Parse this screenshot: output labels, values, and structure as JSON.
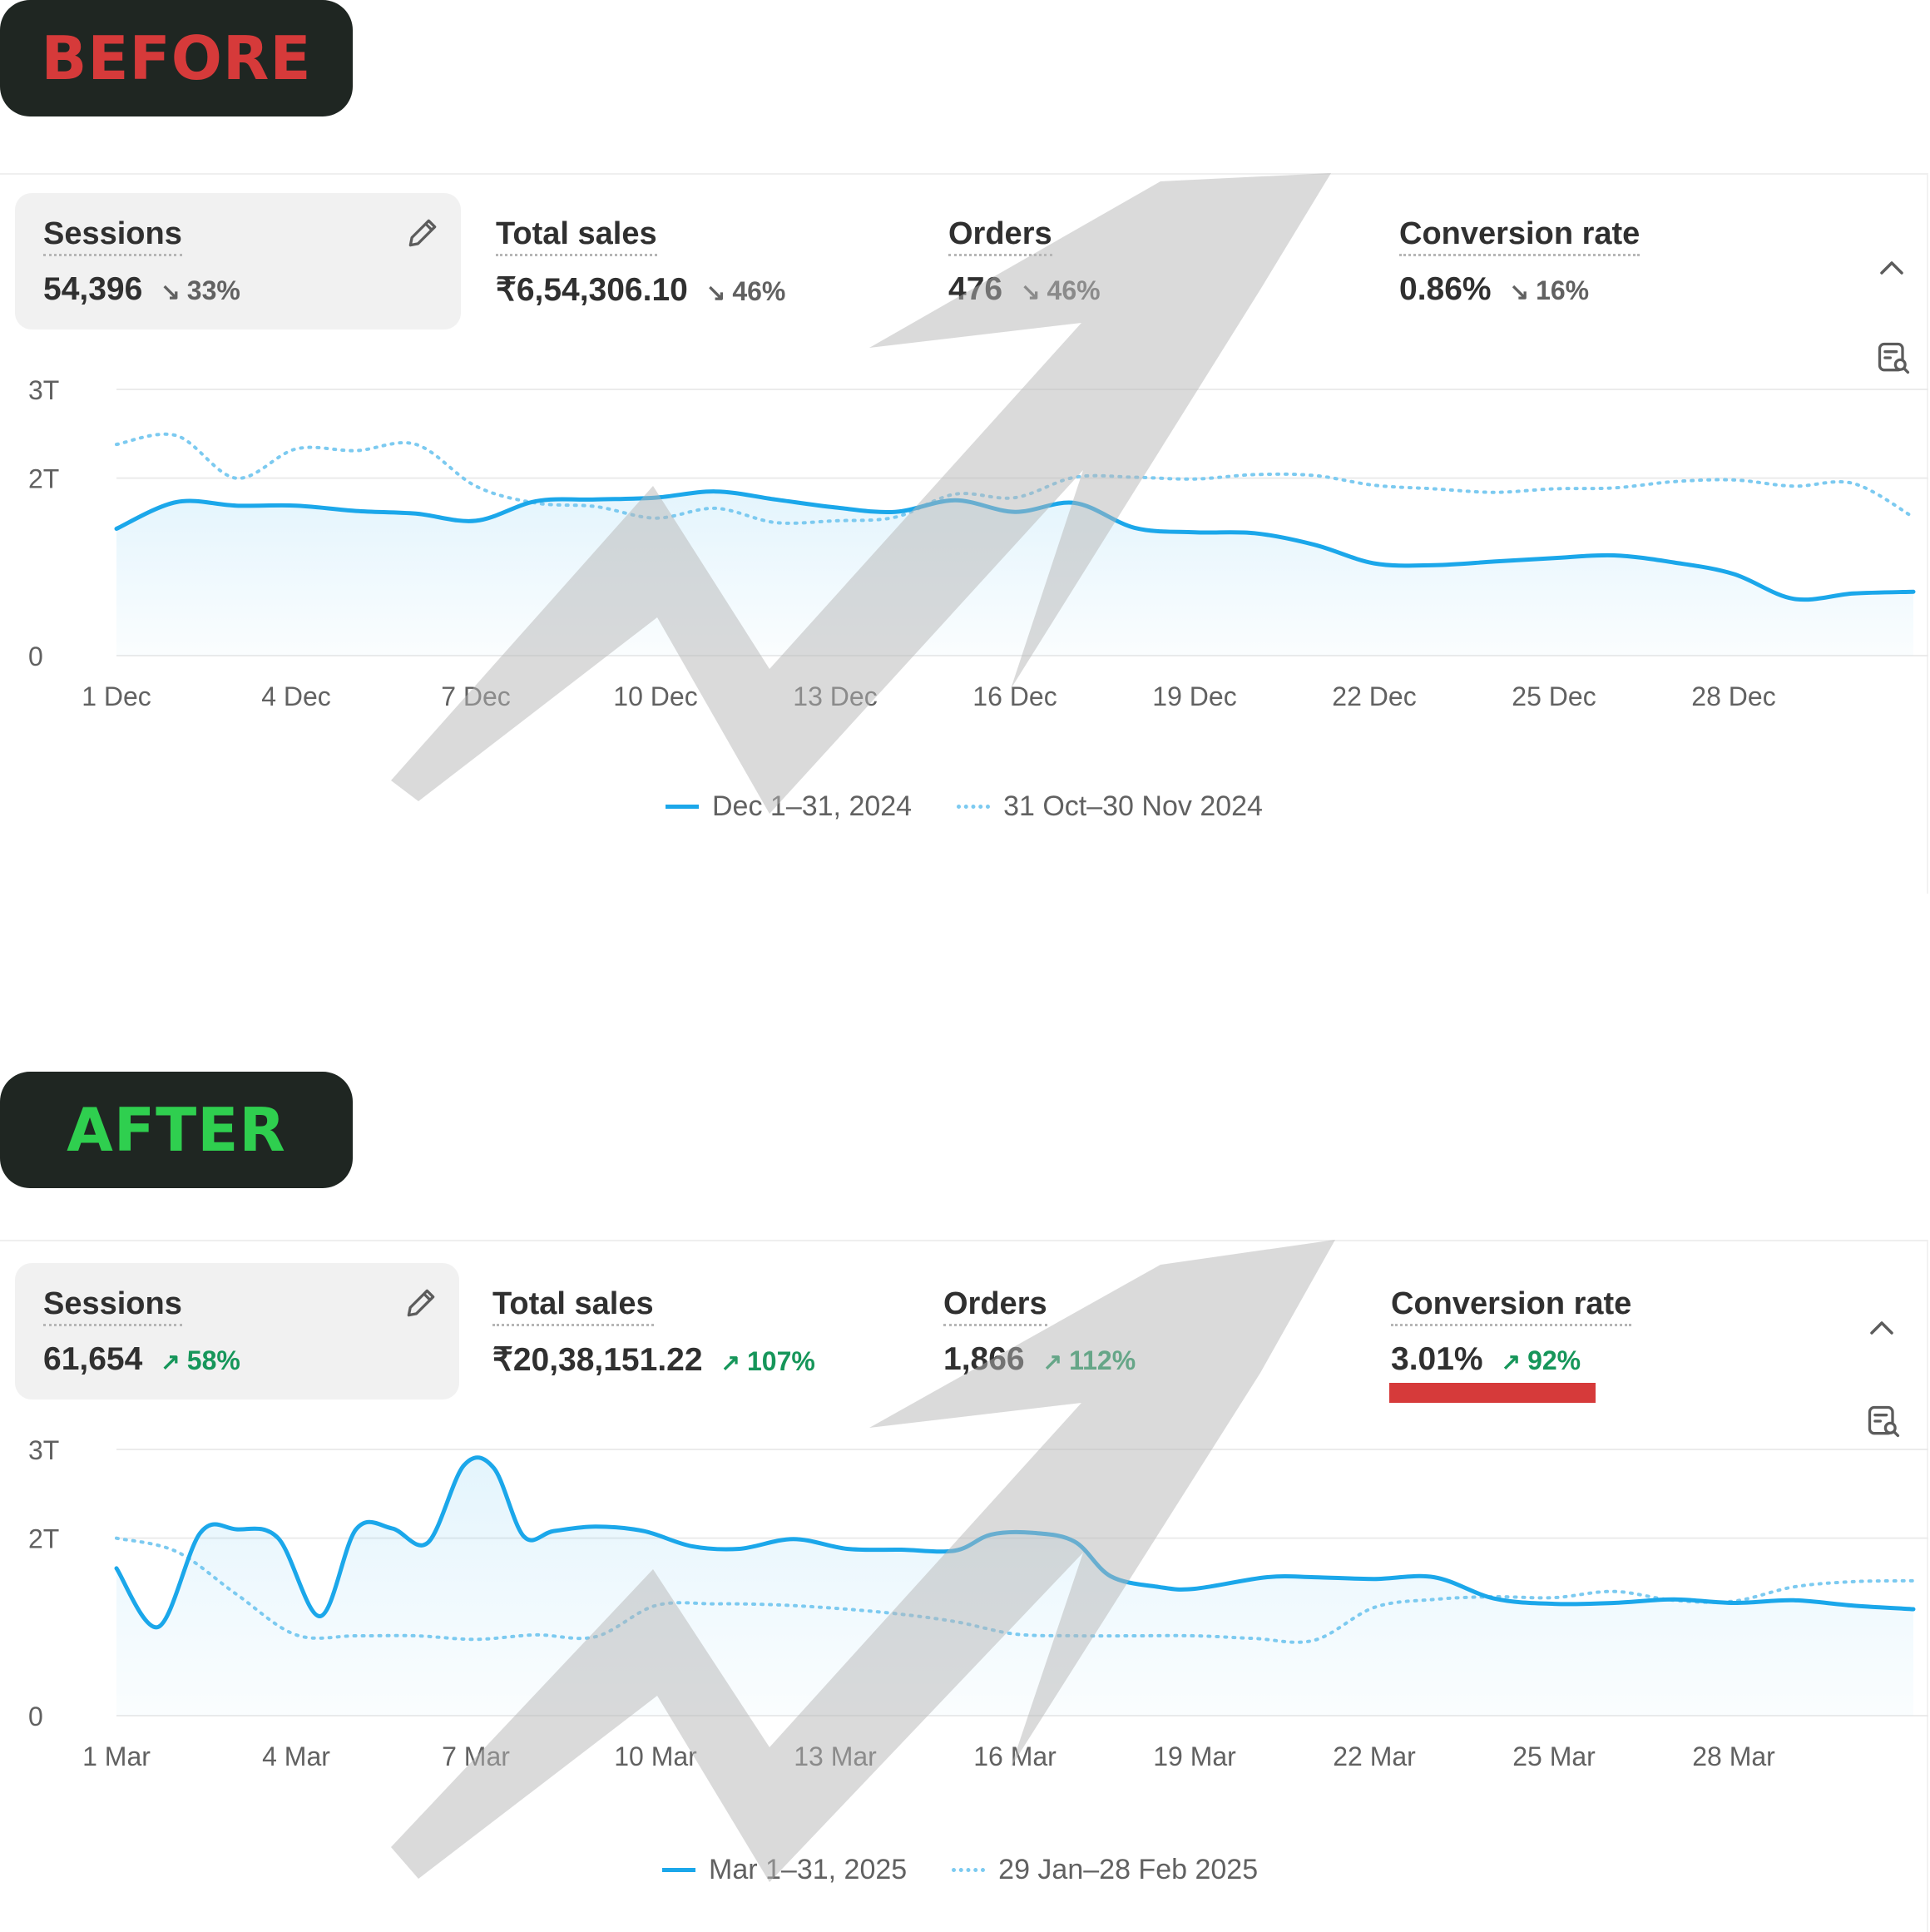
{
  "labels": {
    "before": "BEFORE",
    "after": "AFTER"
  },
  "colors": {
    "series_current": "#1ba7ea",
    "series_previous": "#7ccaf0",
    "up": "#16965a",
    "down": "#616161",
    "badge_bg": "#1f2622",
    "before_text": "#d63a3a",
    "after_text": "#2fcf4f",
    "highlight": "#d63a3a"
  },
  "icons": {
    "edit": "pencil-icon",
    "collapse": "chevron-up-icon",
    "report": "report-search-icon",
    "watermark": "trend-up-arrow-icon"
  },
  "before": {
    "metrics": [
      {
        "label": "Sessions",
        "value": "54,396",
        "delta": "33%",
        "direction": "down",
        "selected": true
      },
      {
        "label": "Total sales",
        "value": "₹6,54,306.10",
        "delta": "46%",
        "direction": "down"
      },
      {
        "label": "Orders",
        "value": "476",
        "delta": "46%",
        "direction": "down"
      },
      {
        "label": "Conversion rate",
        "value": "0.86%",
        "delta": "16%",
        "direction": "down"
      }
    ],
    "legend": {
      "current": "Dec 1–31, 2024",
      "previous": "31 Oct–30 Nov 2024"
    }
  },
  "after": {
    "metrics": [
      {
        "label": "Sessions",
        "value": "61,654",
        "delta": "58%",
        "direction": "up",
        "selected": true
      },
      {
        "label": "Total sales",
        "value": "₹20,38,151.22",
        "delta": "107%",
        "direction": "up"
      },
      {
        "label": "Orders",
        "value": "1,866",
        "delta": "112%",
        "direction": "up"
      },
      {
        "label": "Conversion rate",
        "value": "3.01%",
        "delta": "92%",
        "direction": "up",
        "highlighted": true
      }
    ],
    "legend": {
      "current": "Mar 1–31, 2025",
      "previous": "29 Jan–28 Feb 2025"
    }
  },
  "chart_data": [
    {
      "type": "line",
      "yticks": [
        "0",
        "2T",
        "3T"
      ],
      "ylim": [
        0,
        3000
      ],
      "x_tick_labels": [
        "1 Dec",
        "4 Dec",
        "7 Dec",
        "10 Dec",
        "13 Dec",
        "16 Dec",
        "19 Dec",
        "22 Dec",
        "25 Dec",
        "28 Dec"
      ],
      "x_tick_days": [
        1,
        4,
        7,
        10,
        13,
        16,
        19,
        22,
        25,
        28
      ],
      "xlim": [
        1,
        31
      ],
      "grid": true,
      "legend_position": "bottom",
      "series": [
        {
          "name": "Dec 1–31, 2024",
          "style": "solid",
          "x": [
            1,
            2,
            3,
            4,
            5,
            6,
            7,
            8,
            9,
            10,
            11,
            12,
            13,
            14,
            15,
            16,
            17,
            18,
            19,
            20,
            21,
            22,
            23,
            24,
            25,
            26,
            27,
            28,
            29,
            30,
            31
          ],
          "values": [
            1430,
            1730,
            1690,
            1690,
            1630,
            1600,
            1520,
            1740,
            1760,
            1780,
            1850,
            1760,
            1670,
            1620,
            1750,
            1620,
            1720,
            1440,
            1390,
            1380,
            1250,
            1040,
            1020,
            1060,
            1100,
            1130,
            1050,
            920,
            640,
            700,
            720
          ]
        },
        {
          "name": "31 Oct–30 Nov 2024",
          "style": "dotted",
          "x": [
            1,
            2,
            3,
            4,
            5,
            6,
            7,
            8,
            9,
            10,
            11,
            12,
            13,
            14,
            15,
            16,
            17,
            18,
            19,
            20,
            21,
            22,
            23,
            24,
            25,
            26,
            27,
            28,
            29,
            30,
            31
          ],
          "values": [
            2380,
            2480,
            2000,
            2330,
            2310,
            2380,
            1910,
            1720,
            1680,
            1550,
            1660,
            1500,
            1520,
            1560,
            1820,
            1780,
            2010,
            2010,
            1990,
            2040,
            2030,
            1920,
            1880,
            1840,
            1880,
            1890,
            1960,
            1980,
            1910,
            1940,
            1560
          ]
        }
      ]
    },
    {
      "type": "line",
      "yticks": [
        "0",
        "2T",
        "3T"
      ],
      "ylim": [
        0,
        3000
      ],
      "x_tick_labels": [
        "1 Mar",
        "4 Mar",
        "7 Mar",
        "10 Mar",
        "13 Mar",
        "16 Mar",
        "19 Mar",
        "22 Mar",
        "25 Mar",
        "28 Mar"
      ],
      "x_tick_days": [
        1,
        4,
        7,
        10,
        13,
        16,
        19,
        22,
        25,
        28
      ],
      "xlim": [
        1,
        31
      ],
      "grid": true,
      "legend_position": "bottom",
      "series": [
        {
          "name": "Mar 1–31, 2025",
          "style": "solid",
          "x": [
            1,
            1.7,
            2.4,
            3,
            3.7,
            4.4,
            5,
            5.6,
            6.2,
            6.8,
            7.3,
            7.8,
            8.3,
            9,
            9.8,
            10.6,
            11.4,
            12.3,
            13.2,
            14.1,
            15,
            15.6,
            16.3,
            17,
            17.6,
            18.4,
            19,
            20.2,
            21,
            22,
            23,
            24,
            25,
            26,
            27,
            28,
            29,
            30,
            31
          ],
          "values": [
            1660,
            1000,
            2060,
            2100,
            2000,
            1120,
            2100,
            2110,
            1950,
            2820,
            2790,
            2020,
            2080,
            2130,
            2080,
            1910,
            1880,
            1990,
            1880,
            1870,
            1860,
            2040,
            2060,
            1960,
            1570,
            1450,
            1430,
            1560,
            1560,
            1540,
            1560,
            1320,
            1260,
            1270,
            1310,
            1270,
            1300,
            1240,
            1200
          ]
        },
        {
          "name": "29 Jan–28 Feb 2025",
          "style": "dotted",
          "x": [
            1,
            2,
            3,
            4,
            5,
            6,
            7,
            8,
            9,
            10,
            11,
            12,
            13,
            14,
            15,
            16,
            17,
            18,
            19,
            20,
            21,
            22,
            23,
            24,
            25,
            26,
            27,
            28,
            29,
            30,
            31
          ],
          "values": [
            2000,
            1850,
            1370,
            910,
            900,
            900,
            860,
            910,
            890,
            1240,
            1260,
            1250,
            1210,
            1150,
            1060,
            920,
            900,
            900,
            900,
            870,
            850,
            1220,
            1310,
            1340,
            1330,
            1400,
            1300,
            1290,
            1450,
            1510,
            1520
          ]
        }
      ]
    }
  ]
}
